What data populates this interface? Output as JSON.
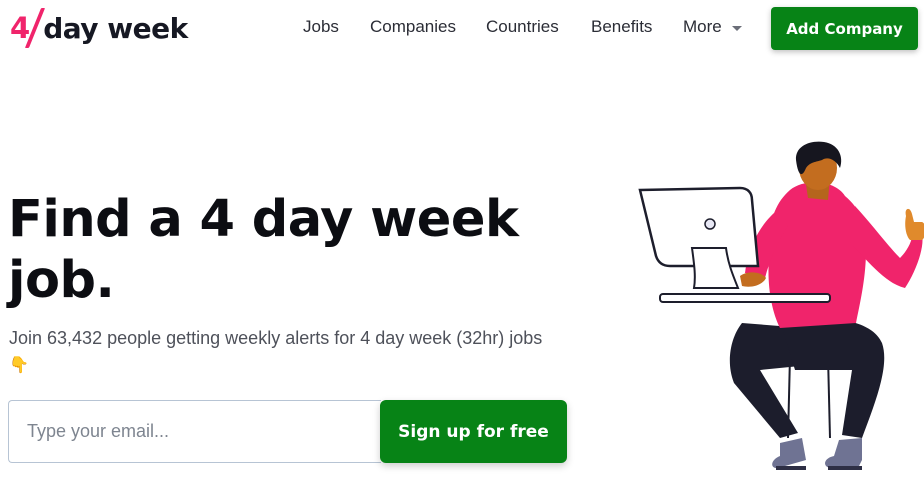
{
  "header": {
    "logo": {
      "number": "4",
      "text": "day week"
    },
    "nav": {
      "jobs": "Jobs",
      "companies": "Companies",
      "countries": "Countries",
      "benefits": "Benefits",
      "more": "More"
    },
    "add_company": "Add Company"
  },
  "hero": {
    "title": "Find a 4 day week job.",
    "subtitle": "Join 63,432 people getting weekly alerts for 4 day week (32hr) jobs",
    "emoji": "👇",
    "email_placeholder": "Type your email...",
    "signup_label": "Sign up for free"
  },
  "colors": {
    "brand_pink": "#f0246b",
    "cta_green": "#078316",
    "dark": "#161823"
  },
  "icons": {
    "more_caret": "chevron-down-icon",
    "hero_emoji": "pointing-down-hand-icon"
  }
}
